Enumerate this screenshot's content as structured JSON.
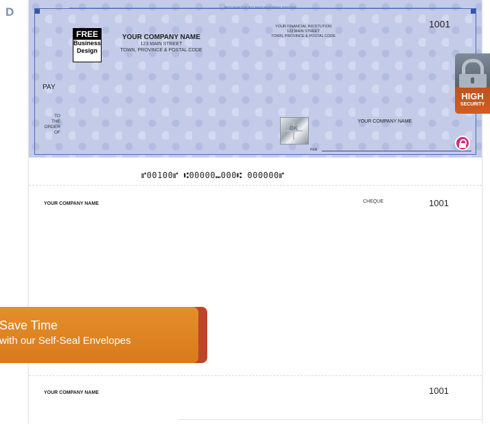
{
  "page_letter": "D",
  "cheque": {
    "microprint_text": "BEST SENSITIVE TEXT MADE MICROPRINT WITH TEXT",
    "logo": {
      "top": "FREE",
      "line1": "Business",
      "line2": "Design"
    },
    "company": {
      "name": "YOUR COMPANY NAME",
      "street": "123 MAIN STREET",
      "city": "TOWN, PROVINCE & POSTAL CODE"
    },
    "bank": {
      "name": "YOUR FINANCIAL INSTITUTION",
      "street": "123 MAIN STREET",
      "city": "TOWN, PROVINCE & POSTAL CODE"
    },
    "number": "1001",
    "pay_label": "PAY",
    "to_order": {
      "l1": "TO",
      "l2": "THE",
      "l3": "ORDER",
      "l4": "OF"
    },
    "hologram_text": "OK",
    "signature_company": "YOUR COMPANY NAME",
    "per_label": "PER",
    "micr": "⑈00100⑈ ⑆00000⑉000⑆ 000000⑈"
  },
  "stub1": {
    "company": "YOUR COMPANY NAME",
    "cheque_label": "CHEQUE",
    "number": "1001"
  },
  "stub2": {
    "company": "YOUR COMPANY NAME",
    "number": "1001"
  },
  "security_badge": {
    "high": "HIGH",
    "security": "SECURITY"
  },
  "banner": {
    "title": "Save Time",
    "subtitle": "with our Self-Seal Envelopes"
  },
  "colors": {
    "cheque_background": "#c3cbe8",
    "cheque_border": "#4a69b5",
    "banner_orange": "#e38f2a",
    "banner_red": "#c0442a",
    "lock_pink": "#d9297a"
  }
}
